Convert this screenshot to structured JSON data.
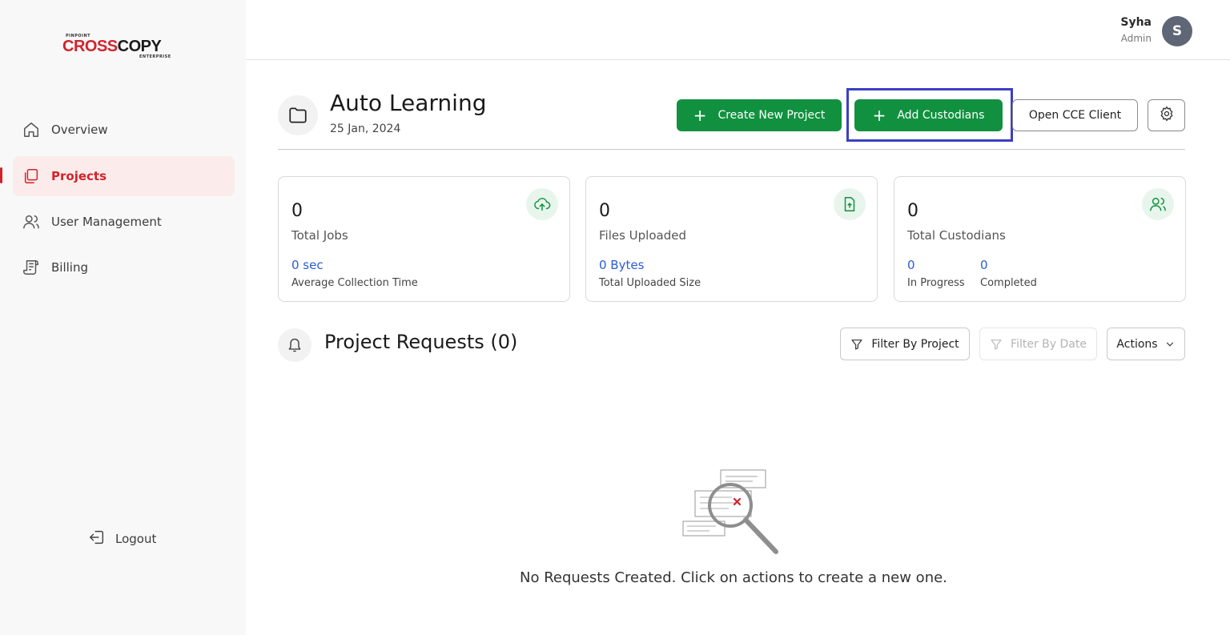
{
  "brand": {
    "top": "PINPOINT",
    "name_red": "CROSS",
    "name_dark": "COPY",
    "bottom": "ENTERPRISE"
  },
  "sidebar": {
    "items": [
      {
        "label": "Overview",
        "icon": "home-icon"
      },
      {
        "label": "Projects",
        "icon": "projects-icon",
        "active": true
      },
      {
        "label": "User Management",
        "icon": "users-icon"
      },
      {
        "label": "Billing",
        "icon": "billing-icon"
      }
    ],
    "logout_label": "Logout"
  },
  "user": {
    "name": "Syha",
    "role": "Admin",
    "initial": "S"
  },
  "project": {
    "title": "Auto Learning",
    "date": "25 Jan, 2024",
    "create_label": "Create New Project",
    "add_custodians_label": "Add Custodians",
    "open_client_label": "Open CCE Client"
  },
  "stats": {
    "jobs": {
      "count": "0",
      "label": "Total Jobs",
      "value": "0 sec",
      "sub": "Average Collection Time"
    },
    "files": {
      "count": "0",
      "label": "Files Uploaded",
      "value": "0 Bytes",
      "sub": "Total Uploaded Size"
    },
    "custodians": {
      "count": "0",
      "label": "Total Custodians",
      "in_progress_value": "0",
      "in_progress_label": "In Progress",
      "completed_value": "0",
      "completed_label": "Completed"
    }
  },
  "requests": {
    "title": "Project Requests (0)",
    "filter_project": "Filter By Project",
    "filter_date": "Filter By Date",
    "actions": "Actions",
    "empty_text": "No Requests Created. Click on actions to create a new one."
  },
  "colors": {
    "primary_green": "#11913f",
    "brand_red": "#d3222a",
    "link_blue": "#2a5bd7",
    "highlight": "#3b3fc4"
  }
}
